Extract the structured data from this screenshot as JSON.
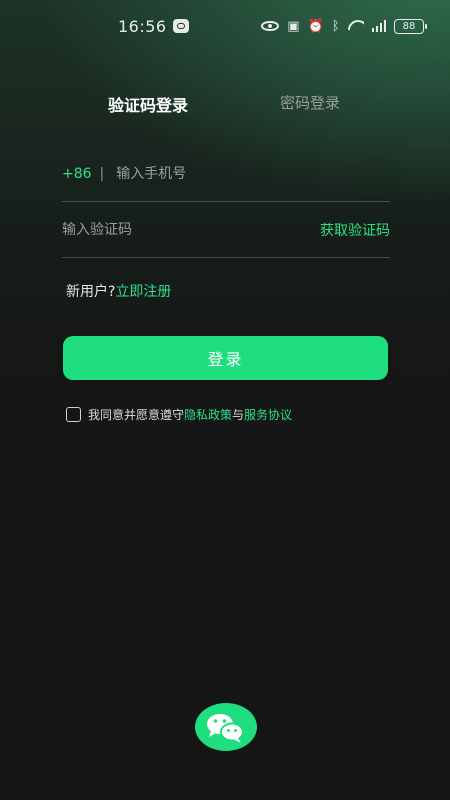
{
  "status_bar": {
    "time": "16:56",
    "battery": "88",
    "icons": [
      "message-icon",
      "eye-icon",
      "nfc-icon",
      "alarm-icon",
      "bluetooth-icon",
      "wifi-icon",
      "signal-icon",
      "battery-icon"
    ]
  },
  "tabs": [
    {
      "label": "验证码登录",
      "active": true
    },
    {
      "label": "密码登录",
      "active": false
    }
  ],
  "phone": {
    "country_code": "+86",
    "separator": "|",
    "placeholder": "输入手机号",
    "value": ""
  },
  "code": {
    "placeholder": "输入验证码",
    "value": "",
    "get_code_label": "获取验证码"
  },
  "register": {
    "prompt": "新用户?",
    "link": "立即注册"
  },
  "login_button": {
    "label": "登录"
  },
  "agreement": {
    "checked": false,
    "prefix": "我同意并愿意遵守",
    "privacy_link": "隐私政策",
    "conjunction": "与",
    "service_link": "服务协议"
  },
  "wechat": {
    "icon": "wechat-icon"
  },
  "colors": {
    "accent": "#1fde7f",
    "accent_text": "#2ee08a",
    "background": "#151515",
    "gradient_top": "#2e6a4c"
  }
}
